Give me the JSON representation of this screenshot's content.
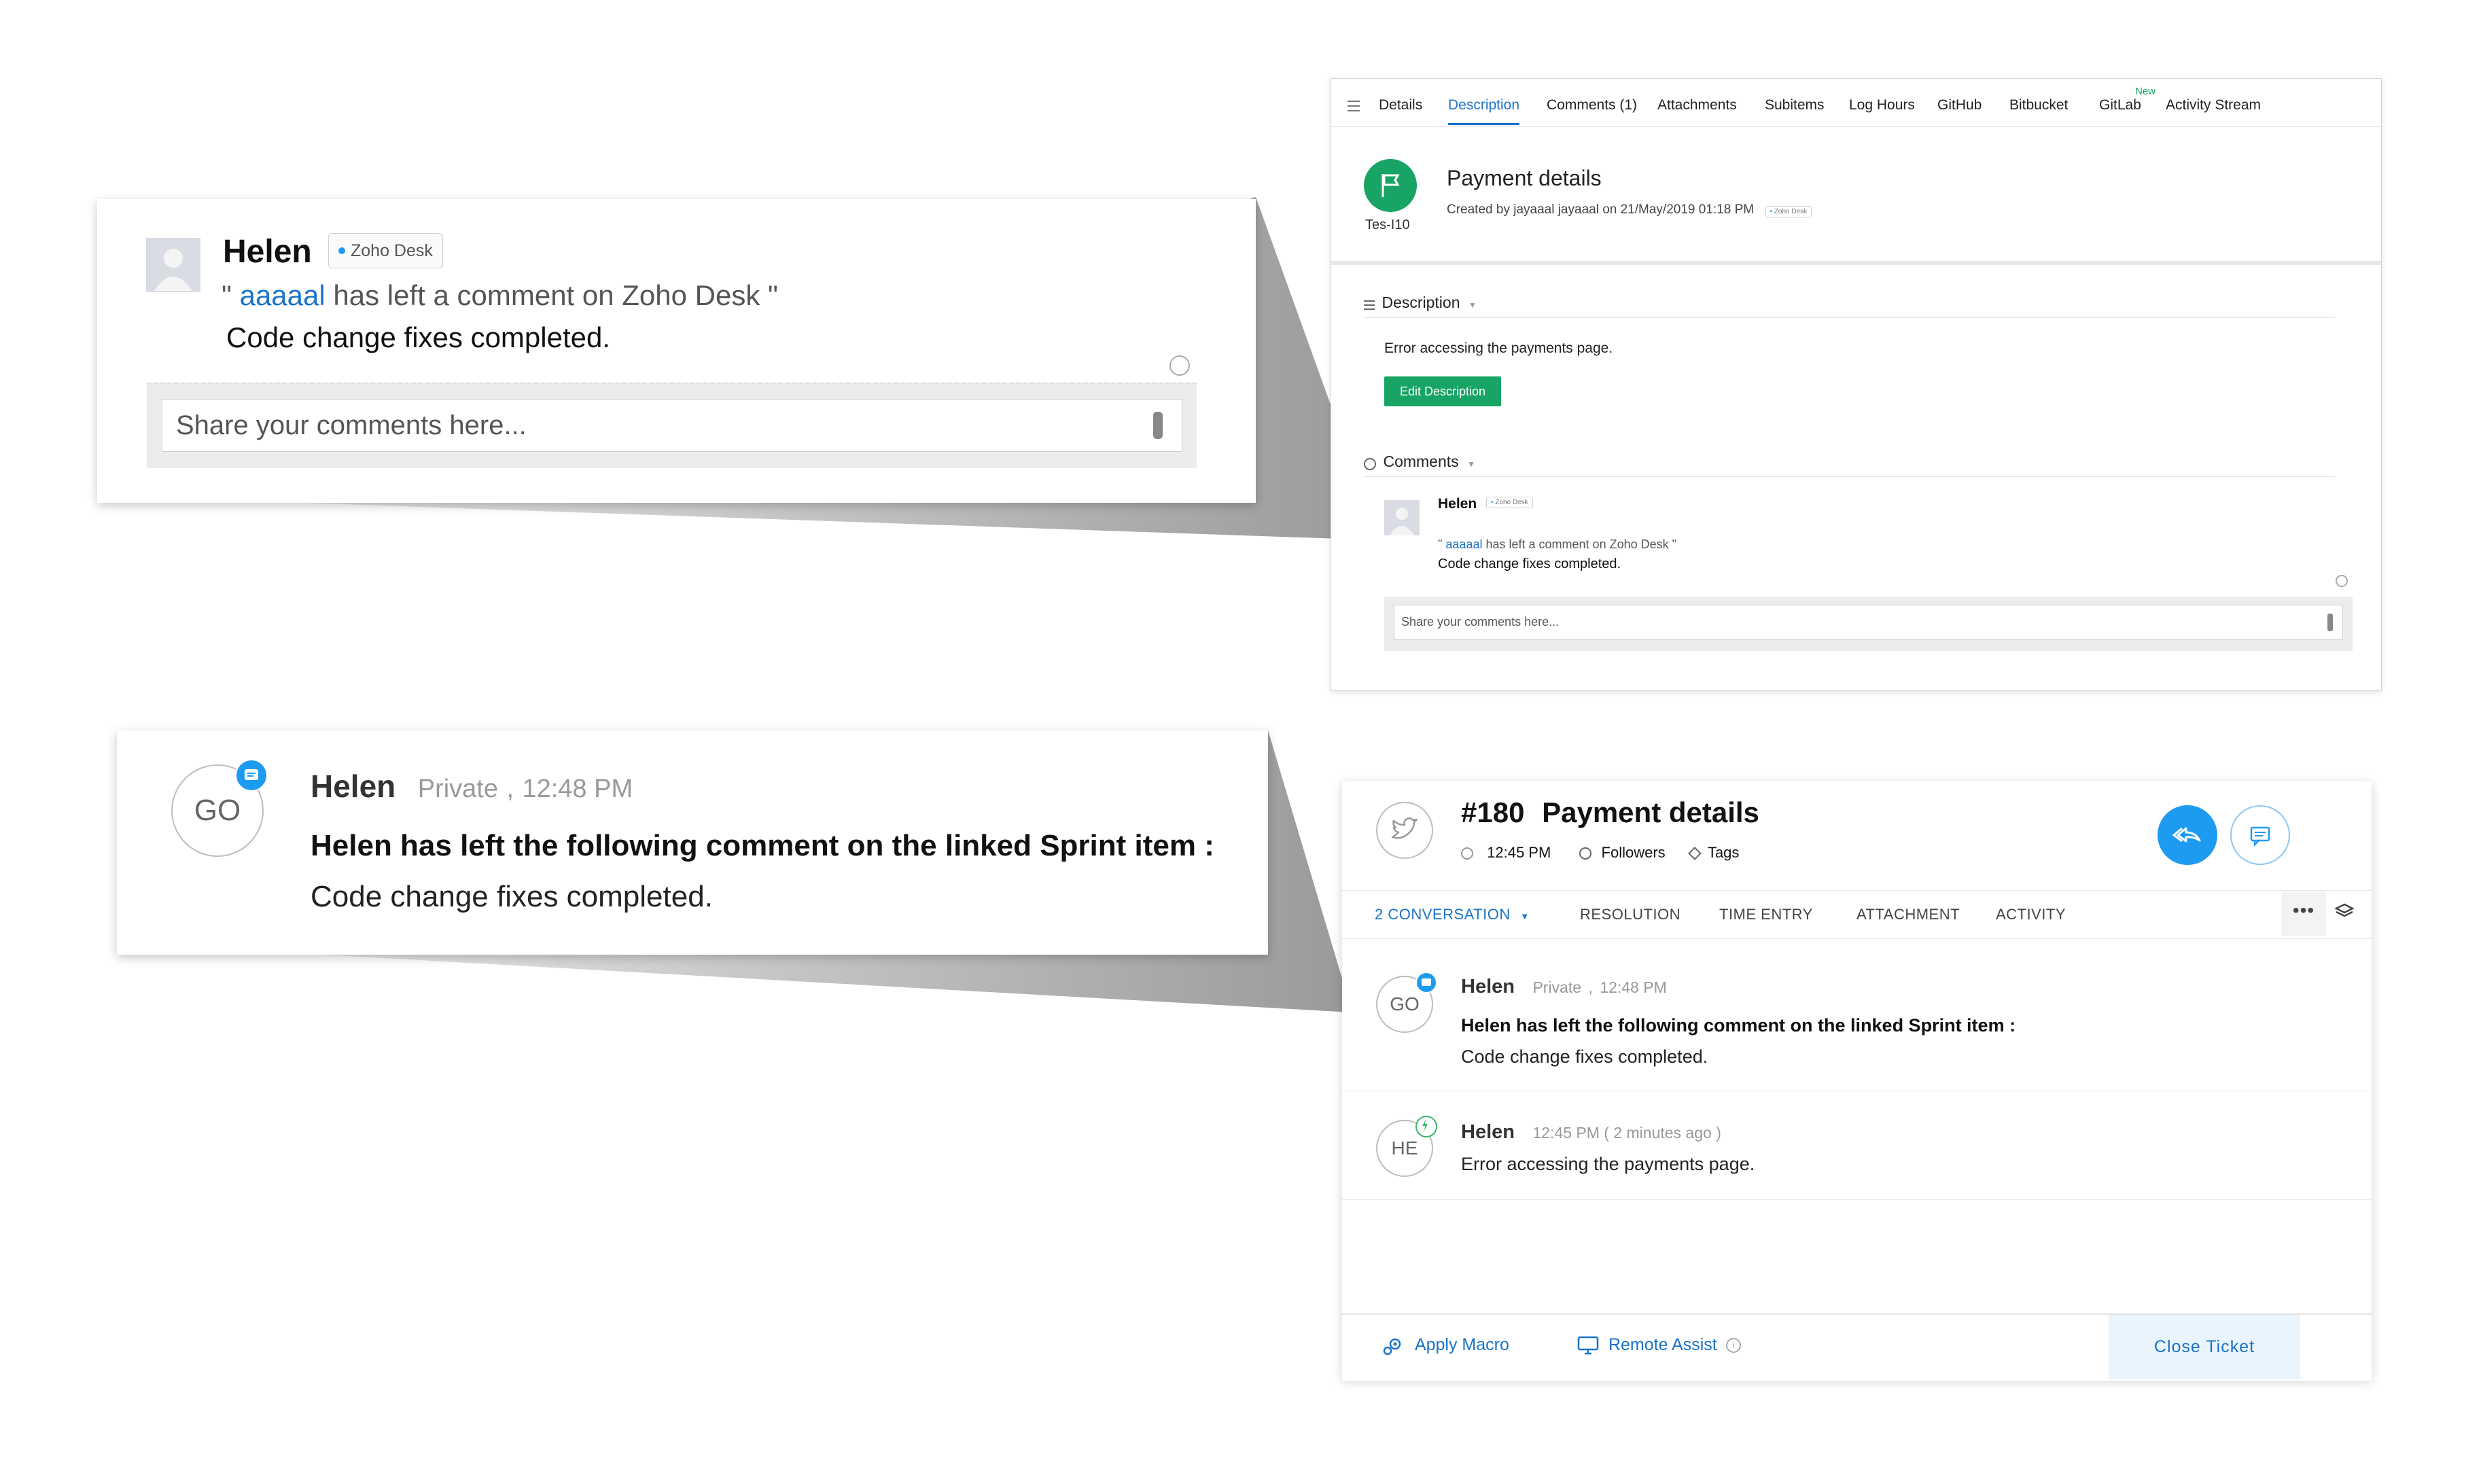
{
  "sprints_panel": {
    "tabs": [
      {
        "label": "Details"
      },
      {
        "label": "Description",
        "active": true
      },
      {
        "label": "Comments (1)"
      },
      {
        "label": "Attachments"
      },
      {
        "label": "Subitems"
      },
      {
        "label": "Log Hours"
      },
      {
        "label": "GitHub"
      },
      {
        "label": "Bitbucket"
      },
      {
        "label": "GitLab"
      },
      {
        "label": "Activity Stream"
      }
    ],
    "new_badge": "New",
    "item_id": "Tes-I10",
    "title": "Payment details",
    "created_by": "Created by jayaaal jayaaal on 21/May/2019 01:18 PM",
    "source_tag": "Zoho Desk",
    "description_heading": "Description",
    "description_text": "Error accessing the payments page.",
    "edit_button": "Edit Description",
    "comments_heading": "Comments",
    "comment": {
      "author": "Helen",
      "source_tag": "Zoho Desk",
      "quote_open": "\"",
      "user_link": "aaaaal",
      "message": "has left a comment on Zoho Desk",
      "quote_close": "\"",
      "body": "Code change fixes completed."
    },
    "comment_placeholder": "Share your comments here..."
  },
  "zoom_comment": {
    "author": "Helen",
    "source_tag": "Zoho Desk",
    "quote_open": "\"",
    "user_link": "aaaaal",
    "message": "has left a comment on Zoho Desk",
    "quote_close": "\"",
    "body": "Code change fixes completed.",
    "placeholder": "Share your comments here..."
  },
  "zoom_thread": {
    "avatar": "GO",
    "author": "Helen",
    "visibility": "Private",
    "separator": ",",
    "time": "12:48 PM",
    "heading": "Helen has left the following comment on the linked Sprint item :",
    "body": "Code change fixes completed."
  },
  "desk_panel": {
    "ticket_number": "#180",
    "title": "Payment details",
    "time": "12:45 PM",
    "followers": "Followers",
    "tags": "Tags",
    "tabs": [
      {
        "label": "2 CONVERSATION",
        "active": true
      },
      {
        "label": "RESOLUTION"
      },
      {
        "label": "TIME ENTRY"
      },
      {
        "label": "ATTACHMENT"
      },
      {
        "label": "ACTIVITY"
      }
    ],
    "threads": [
      {
        "avatar": "GO",
        "author": "Helen",
        "visibility": "Private",
        "separator": ",",
        "time": "12:48 PM",
        "heading": "Helen has left the following comment on the linked Sprint item :",
        "body": "Code change fixes completed."
      },
      {
        "avatar": "HE",
        "author": "Helen",
        "time": "12:45 PM ( 2 minutes ago )",
        "body": "Error accessing the payments page."
      }
    ],
    "footer": {
      "apply_macro": "Apply Macro",
      "remote_assist": "Remote Assist",
      "close_ticket": "Close Ticket"
    }
  },
  "colors": {
    "link_blue": "#1a73c9",
    "green": "#18a465",
    "desk_blue": "#1d9bf0",
    "close_bg": "#e9f4fc"
  }
}
